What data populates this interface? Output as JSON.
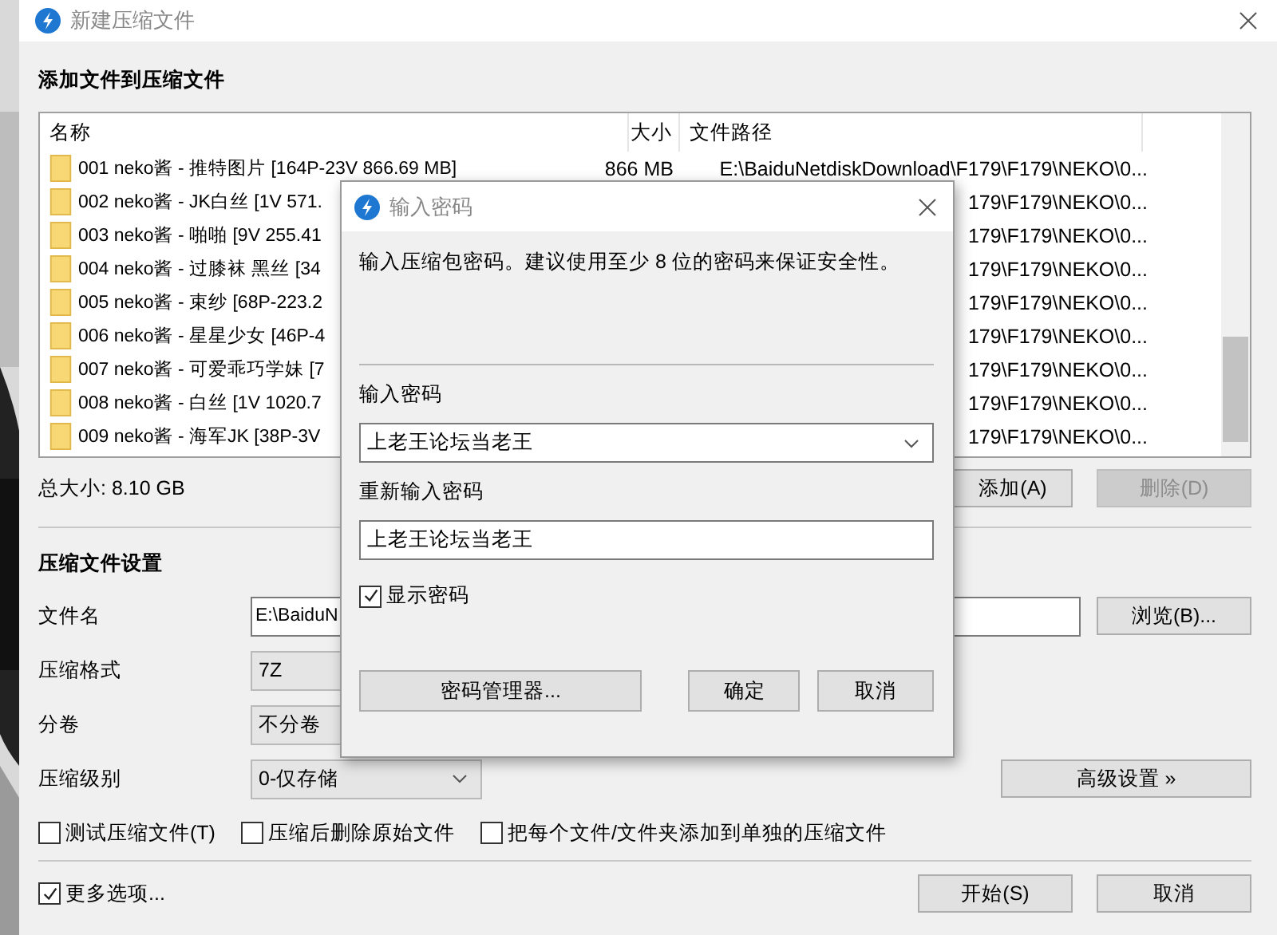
{
  "window": {
    "title": "新建压缩文件"
  },
  "files": {
    "heading": "添加文件到压缩文件",
    "columns": [
      "名称",
      "大小",
      "文件路径"
    ],
    "rows": [
      {
        "name": "001 neko酱 - 推特图片 [164P-23V 866.69 MB]",
        "size": "866 MB",
        "path": "E:\\BaiduNetdiskDownload\\F179\\F179\\NEKO\\0..."
      },
      {
        "name": "002 neko酱 - JK白丝 [1V 571.",
        "path": "179\\F179\\NEKO\\0..."
      },
      {
        "name": "003 neko酱 - 啪啪 [9V 255.41",
        "path": "179\\F179\\NEKO\\0..."
      },
      {
        "name": "004 neko酱 - 过膝袜 黑丝 [34",
        "path": "179\\F179\\NEKO\\0..."
      },
      {
        "name": "005 neko酱 - 束纱 [68P-223.2",
        "path": "179\\F179\\NEKO\\0..."
      },
      {
        "name": "006 neko酱 - 星星少女 [46P-4",
        "path": "179\\F179\\NEKO\\0..."
      },
      {
        "name": "007 neko酱 - 可爱乖巧学妹 [7",
        "path": "179\\F179\\NEKO\\0..."
      },
      {
        "name": "008 neko酱 - 白丝 [1V 1020.7",
        "path": "179\\F179\\NEKO\\0..."
      },
      {
        "name": "009 neko酱 - 海军JK [38P-3V",
        "path": "179\\F179\\NEKO\\0..."
      }
    ],
    "total_size": "总大小: 8.10 GB",
    "buttons": [
      {
        "label": "添加(A)",
        "disabled": false
      },
      {
        "label": "删除(D)",
        "disabled": true
      }
    ]
  },
  "settings": {
    "heading": "压缩文件设置",
    "fields": [
      {
        "kind": "text",
        "label": "文件名",
        "value": "E:\\BaiduN",
        "button": "浏览(B)..."
      },
      {
        "kind": "box",
        "label": "压缩格式",
        "value": "7Z"
      },
      {
        "kind": "box",
        "label": "分卷",
        "value": "不分卷"
      },
      {
        "kind": "combo",
        "label": "压缩级别",
        "value": "0-仅存储",
        "button": "高级设置 »"
      }
    ],
    "checkboxes": [
      {
        "label": "测试压缩文件(T)",
        "checked": false
      },
      {
        "label": "压缩后删除原始文件",
        "checked": false
      },
      {
        "label": "把每个文件/文件夹添加到单独的压缩文件",
        "checked": false
      }
    ]
  },
  "more_options": {
    "label": "更多选项...",
    "checked": true
  },
  "buttons": [
    "开始(S)",
    "取消"
  ],
  "password_dialog": {
    "title": "输入密码",
    "message": "输入压缩包密码。建议使用至少 8 位的密码来保证安全性。",
    "password_label": "输入密码",
    "password_value": "上老王论坛当老王",
    "confirm_label": "重新输入密码",
    "confirm_value": "上老王论坛当老王",
    "show_password": {
      "label": "显示密码",
      "checked": true
    },
    "buttons": [
      "密码管理器...",
      "确定",
      "取消"
    ]
  }
}
